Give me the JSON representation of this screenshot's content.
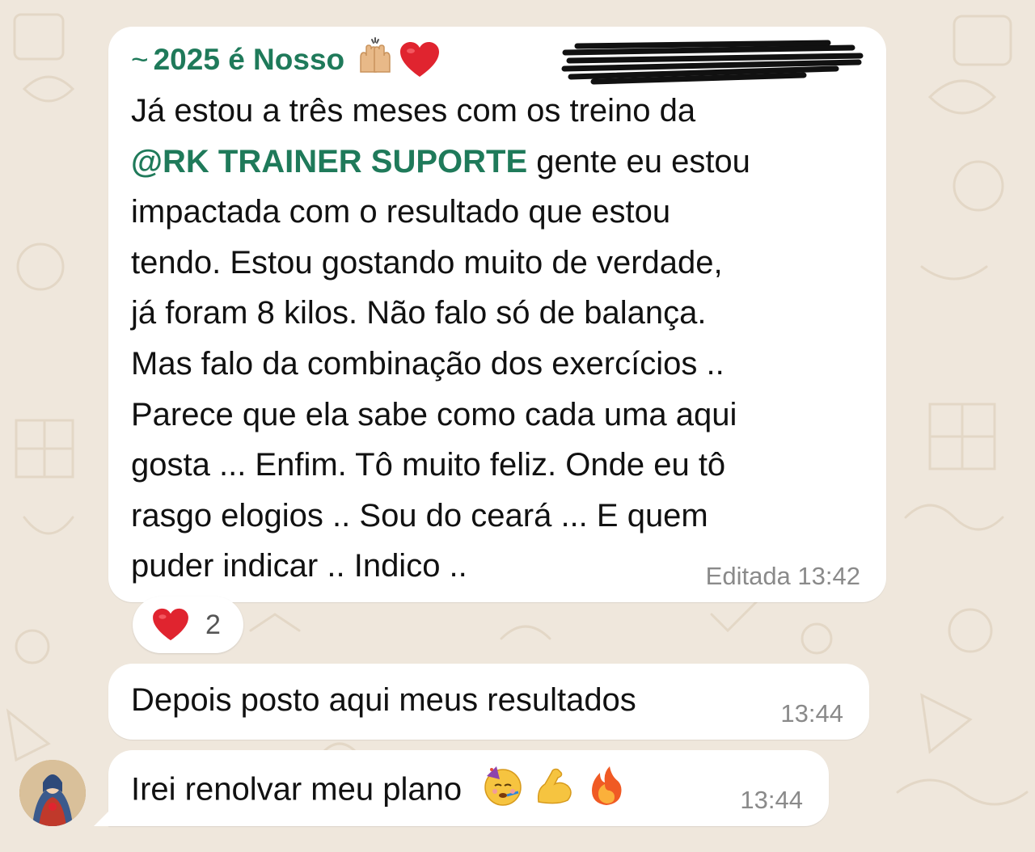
{
  "colors": {
    "accent_green": "#1f7a5a",
    "bubble_bg": "#ffffff",
    "chat_bg": "#efe7dc",
    "timestamp_gray": "#8a8a8a",
    "heart_red": "#e0242f"
  },
  "messages": [
    {
      "sender_prefix": "~",
      "sender_name": "2025 é Nosso",
      "sender_emojis": [
        "raising-hands-icon",
        "red-heart-icon"
      ],
      "text_before_mention": "Já estou a três meses com os treino da\n",
      "mention": "@RK TRAINER SUPORTE",
      "text_after_mention": " gente eu estou\nimpactada com o resultado que estou\ntendo. Estou gostando muito de verdade,\njá foram 8 kilos. Não falo só de balança.\nMas falo da combinação dos exercícios ..\nParece que ela sabe como cada uma aqui\ngosta ... Enfim. Tô muito feliz. Onde eu tô\nrasgo elogios .. Sou do ceará ... E quem\npuder indicar .. Indico ..",
      "edited_label": "Editada",
      "time": "13:42",
      "reaction": {
        "icon": "red-heart-icon",
        "count": "2"
      }
    },
    {
      "text": "Depois posto aqui meus resultados",
      "time": "13:44"
    },
    {
      "text": "Irei renolvar meu plano",
      "emojis": [
        "partying-face-icon",
        "flexed-biceps-icon",
        "fire-icon"
      ],
      "time": "13:44"
    }
  ]
}
